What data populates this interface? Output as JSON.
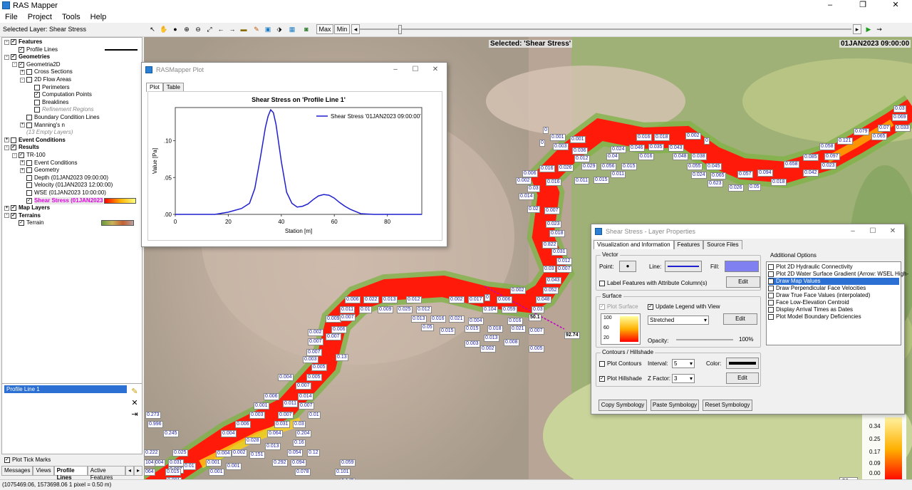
{
  "app": {
    "title": "RAS Mapper",
    "minimize": "–",
    "maximize": "❐",
    "close": "✕"
  },
  "menu": [
    "File",
    "Project",
    "Tools",
    "Help"
  ],
  "toolbar": {
    "selected_layer": "Selected Layer: Shear Stress",
    "max_label": "Max",
    "min_label": "Min"
  },
  "tree": [
    {
      "label": "Features",
      "lvl": 0,
      "exp": "-",
      "chk": "✓",
      "bold": true
    },
    {
      "label": "Profile Lines",
      "lvl": 1,
      "exp": "",
      "chk": "✓"
    },
    {
      "label": "Geometries",
      "lvl": 0,
      "exp": "-",
      "chk": "✓",
      "bold": true
    },
    {
      "label": "Geometria2D",
      "lvl": 1,
      "exp": "-",
      "chk": "✓"
    },
    {
      "label": "Cross Sections",
      "lvl": 2,
      "exp": "+",
      "chk": ""
    },
    {
      "label": "2D Flow Areas",
      "lvl": 2,
      "exp": "-",
      "chk": ""
    },
    {
      "label": "Perimeters",
      "lvl": 3,
      "exp": "",
      "chk": ""
    },
    {
      "label": "Computation Points",
      "lvl": 3,
      "exp": "",
      "chk": "✓"
    },
    {
      "label": "Breaklines",
      "lvl": 3,
      "exp": "",
      "chk": ""
    },
    {
      "label": "Refinement Regions",
      "lvl": 3,
      "exp": "",
      "chk": "",
      "gray": true
    },
    {
      "label": "Boundary Condition Lines",
      "lvl": 2,
      "exp": "",
      "chk": ""
    },
    {
      "label": "Manning's n",
      "lvl": 2,
      "exp": "+",
      "chk": ""
    },
    {
      "label": "(13 Empty Layers)",
      "lvl": 2,
      "exp": "",
      "chk": null,
      "gray": true
    },
    {
      "label": "Event Conditions",
      "lvl": 0,
      "exp": "+",
      "chk": "",
      "bold": true
    },
    {
      "label": "Results",
      "lvl": 0,
      "exp": "-",
      "chk": "✓",
      "bold": true
    },
    {
      "label": "TR-100",
      "lvl": 1,
      "exp": "-",
      "chk": "✓"
    },
    {
      "label": "Event Conditions",
      "lvl": 2,
      "exp": "+",
      "chk": ""
    },
    {
      "label": "Geometry",
      "lvl": 2,
      "exp": "+",
      "chk": ""
    },
    {
      "label": "Depth (01JAN2023 09:00:00)",
      "lvl": 2,
      "exp": "",
      "chk": ""
    },
    {
      "label": "Velocity (01JAN2023 12:00:00)",
      "lvl": 2,
      "exp": "",
      "chk": ""
    },
    {
      "label": "WSE (01JAN2023 10:00:00)",
      "lvl": 2,
      "exp": "",
      "chk": ""
    },
    {
      "label": "Shear Stress (01JAN2023",
      "lvl": 2,
      "exp": "",
      "chk": "✓",
      "sel": true
    },
    {
      "label": "Map Layers",
      "lvl": 0,
      "exp": "+",
      "chk": "✓",
      "bold": true
    },
    {
      "label": "Terrains",
      "lvl": 0,
      "exp": "-",
      "chk": "✓",
      "bold": true
    },
    {
      "label": "Terrain",
      "lvl": 1,
      "exp": "",
      "chk": "✓"
    }
  ],
  "profile_list": {
    "item": "Profile Line 1",
    "plot_tick_marks": "Plot Tick Marks"
  },
  "left_tabs": [
    "Messages",
    "Views",
    "Profile Lines",
    "Active Features"
  ],
  "status": "(1075469.06, 1573698.06  1 pixel = 0.50 m)",
  "map": {
    "selected": "Selected: 'Shear Stress'",
    "date": "01JAN2023 09:00:00",
    "scale": "50 m",
    "legend_values": [
      "0.34",
      "0.25",
      "0.17",
      "0.09",
      "0.00"
    ],
    "profile_value": "92.74",
    "profile_label": "50.1",
    "labels": [
      [
        "0",
        762,
        178
      ],
      [
        "0.001",
        772,
        188
      ],
      [
        "0.001",
        800,
        191
      ],
      [
        "0",
        757,
        196
      ],
      [
        "0.003",
        776,
        201
      ],
      [
        "0.036",
        803,
        207
      ],
      [
        "0.016",
        893,
        188
      ],
      [
        "0.018",
        918,
        188
      ],
      [
        "0.002",
        962,
        186
      ],
      [
        "0",
        988,
        193
      ],
      [
        "0.024",
        857,
        205
      ],
      [
        "0.046",
        883,
        203
      ],
      [
        "0.035",
        910,
        202
      ],
      [
        "0.043",
        938,
        203
      ],
      [
        "0.012",
        806,
        218
      ],
      [
        "0.04",
        851,
        215
      ],
      [
        "0.016",
        896,
        215
      ],
      [
        "0.048",
        944,
        215
      ],
      [
        "0.038",
        970,
        215
      ],
      [
        "0.016",
        757,
        232
      ],
      [
        "0.026",
        783,
        231
      ],
      [
        "0.029",
        816,
        229
      ],
      [
        "0.056",
        843,
        229
      ],
      [
        "0.015",
        872,
        229
      ],
      [
        "0.055",
        964,
        229
      ],
      [
        "0.045",
        991,
        229
      ],
      [
        "0.011",
        857,
        240
      ],
      [
        "0.006",
        733,
        239
      ],
      [
        "0.024",
        970,
        241
      ],
      [
        "0.065",
        997,
        242
      ],
      [
        "0.057",
        1035,
        240
      ],
      [
        "0.094",
        1063,
        238
      ],
      [
        "0.658",
        1100,
        226
      ],
      [
        "0.042",
        1127,
        238
      ],
      [
        "0.085",
        1127,
        216
      ],
      [
        "0.058",
        1150,
        201
      ],
      [
        "0.097",
        1157,
        215
      ],
      [
        "0.023",
        1152,
        228
      ],
      [
        "0.121",
        1175,
        193
      ],
      [
        "0.079",
        1198,
        180
      ],
      [
        "0.065",
        1223,
        187
      ],
      [
        "0.07",
        1232,
        175
      ],
      [
        "0.033",
        1256,
        175
      ],
      [
        "0.069",
        1252,
        160
      ],
      [
        "0.03",
        1254,
        148
      ],
      [
        "0.002",
        724,
        249
      ],
      [
        "0.016",
        766,
        251
      ],
      [
        "0.011",
        806,
        249
      ],
      [
        "0.015",
        833,
        248
      ],
      [
        "0.623",
        993,
        253
      ],
      [
        "0.026",
        1022,
        259
      ],
      [
        "0.05",
        1050,
        258
      ],
      [
        "0.018",
        1082,
        251
      ],
      [
        "0.03",
        740,
        260
      ],
      [
        "0.014",
        728,
        271
      ],
      [
        "0.02",
        740,
        289
      ],
      [
        "0.007",
        764,
        291
      ],
      [
        "0.023",
        766,
        310
      ],
      [
        "0.018",
        771,
        323
      ],
      [
        "0.822",
        761,
        339
      ],
      [
        "0.031",
        774,
        349
      ],
      [
        "0.012",
        781,
        362
      ],
      [
        "0.03",
        762,
        373
      ],
      [
        "0.007",
        781,
        373
      ],
      [
        "0.043",
        766,
        389
      ],
      [
        "0.052",
        762,
        403
      ],
      [
        "0.048",
        752,
        416
      ],
      [
        "0.006",
        484,
        416
      ],
      [
        "0.022",
        510,
        416
      ],
      [
        "0.013",
        536,
        416
      ],
      [
        "0.012",
        570,
        416
      ],
      [
        "0.002",
        630,
        416
      ],
      [
        "0.017",
        657,
        416
      ],
      [
        "0",
        680,
        413
      ],
      [
        "0.006",
        697,
        416
      ],
      [
        "0.002",
        716,
        403
      ],
      [
        "0.011",
        477,
        430
      ],
      [
        "0.01",
        504,
        430
      ],
      [
        "0.009",
        530,
        430
      ],
      [
        "0.025",
        557,
        430
      ],
      [
        "0.012",
        584,
        430
      ],
      [
        "0.104",
        677,
        430
      ],
      [
        "0.059",
        704,
        430
      ],
      [
        "0.03",
        746,
        430
      ],
      [
        "0.009",
        457,
        443
      ],
      [
        "0.007",
        477,
        441
      ],
      [
        "0.013",
        577,
        443
      ],
      [
        "0.016",
        604,
        443
      ],
      [
        "0.021",
        630,
        443
      ],
      [
        "0.004",
        657,
        446
      ],
      [
        "0.016",
        712,
        446
      ],
      [
        "0.05",
        591,
        455
      ],
      [
        "0.015",
        617,
        460
      ],
      [
        "0.015",
        652,
        457
      ],
      [
        "0.018",
        684,
        457
      ],
      [
        "0.021",
        716,
        457
      ],
      [
        "0.007",
        742,
        460
      ],
      [
        "0.013",
        679,
        470
      ],
      [
        "0.008",
        707,
        476
      ],
      [
        "0.003",
        652,
        478
      ],
      [
        "0.002",
        674,
        485
      ],
      [
        "0.005",
        742,
        485
      ],
      [
        "0.006",
        465,
        458
      ],
      [
        "0.002",
        432,
        462
      ],
      [
        "0.007",
        457,
        468
      ],
      [
        "0.007",
        432,
        475
      ],
      [
        "0.007",
        430,
        490
      ],
      [
        "0.003",
        425,
        500
      ],
      [
        "0.005",
        437,
        511
      ],
      [
        "0.13",
        471,
        497
      ],
      [
        "0.005",
        430,
        525
      ],
      [
        "0.004",
        390,
        525
      ],
      [
        "0.007",
        415,
        537
      ],
      [
        "0.014",
        418,
        552
      ],
      [
        "0.006",
        370,
        552
      ],
      [
        "0.001",
        356,
        565
      ],
      [
        "0.011",
        397,
        562
      ],
      [
        "0.007",
        419,
        565
      ],
      [
        "0.003",
        350,
        578
      ],
      [
        "0.007",
        390,
        578
      ],
      [
        "0.01",
        432,
        578
      ],
      [
        "0.006",
        330,
        591
      ],
      [
        "0.031",
        385,
        591
      ],
      [
        "0.03",
        411,
        591
      ],
      [
        "0.004",
        310,
        604
      ],
      [
        "0.064",
        375,
        604
      ],
      [
        "0.204",
        415,
        604
      ],
      [
        "0.028",
        344,
        614
      ],
      [
        "0.013",
        372,
        622
      ],
      [
        "0.16",
        411,
        617
      ],
      [
        "0.004",
        303,
        632
      ],
      [
        "0.002",
        325,
        631
      ],
      [
        "0.151",
        350,
        634
      ],
      [
        "0.054",
        403,
        631
      ],
      [
        "0.12",
        431,
        631
      ],
      [
        "0.001",
        289,
        645
      ],
      [
        "0.292",
        382,
        645
      ],
      [
        "0.094",
        408,
        645
      ],
      [
        "0.001",
        317,
        650
      ],
      [
        "0.001",
        293,
        658
      ],
      [
        "0.078",
        414,
        658
      ],
      [
        "0.059",
        477,
        645
      ],
      [
        "0.101",
        470,
        658
      ],
      [
        "0.145",
        477,
        671
      ],
      [
        "0.273",
        204,
        578
      ],
      [
        "0.996",
        207,
        591
      ],
      [
        "0.245",
        229,
        604
      ],
      [
        "0.222",
        202,
        631
      ],
      [
        "0.025",
        242,
        631
      ],
      [
        "0.031",
        236,
        645
      ],
      [
        "0.004",
        210,
        645
      ],
      [
        "104",
        202,
        645
      ],
      [
        "0.007",
        236,
        655
      ],
      [
        "0.015",
        232,
        658
      ],
      [
        "0.01",
        257,
        650
      ],
      [
        "0.001",
        233,
        670
      ],
      [
        "0.001",
        256,
        676
      ],
      [
        "064",
        202,
        658
      ]
    ]
  },
  "plot": {
    "window_title": "RASMapper Plot",
    "tabs": [
      "Plot",
      "Table"
    ],
    "chart_data": {
      "type": "line",
      "title": "Shear Stress on 'Profile Line 1'",
      "xlabel": "Station [m]",
      "ylabel": "Value [Pa]",
      "xlim": [
        0,
        93
      ],
      "ylim": [
        0,
        0.145
      ],
      "xticks": [
        0,
        20,
        40,
        60,
        80
      ],
      "yticks": [
        0,
        0.05,
        0.1
      ],
      "ytick_labels": [
        ".00",
        ".05",
        ".10"
      ],
      "legend_position": "top-right",
      "series": [
        {
          "name": "Shear Stress '01JAN2023 09:00:00'",
          "color": "#1f1fcf",
          "x": [
            0,
            15,
            20,
            25,
            28,
            30,
            32,
            34,
            35,
            36,
            37,
            38,
            40,
            42,
            44,
            46,
            48,
            50,
            52,
            54,
            56,
            58,
            60,
            62,
            64,
            66,
            68,
            70,
            75,
            93
          ],
          "y": [
            0,
            0,
            0.003,
            0.008,
            0.015,
            0.035,
            0.075,
            0.118,
            0.133,
            0.142,
            0.138,
            0.122,
            0.072,
            0.03,
            0.015,
            0.01,
            0.011,
            0.014,
            0.02,
            0.025,
            0.027,
            0.026,
            0.022,
            0.016,
            0.011,
            0.007,
            0.004,
            0.001,
            0,
            0
          ]
        }
      ]
    }
  },
  "props": {
    "window_title": "Shear Stress - Layer Properties",
    "tabs": [
      "Visualization and Information",
      "Features",
      "Source Files"
    ],
    "vector": "Vector",
    "point": "Point:",
    "line": "Line:",
    "fill": "Fill:",
    "label_features": "Label Features with Attribute Column(s)",
    "edit": "Edit",
    "surface": "Surface",
    "plot_surface": "Plot Surface",
    "update_legend": "Update Legend with View",
    "stretch": "Stretched",
    "opacity": "Opacity:",
    "opacity_value": "100%",
    "contours": "Contours / Hillshade",
    "plot_contours": "Plot Contours",
    "interval": "Interval:",
    "interval_value": "5",
    "color": "Color:",
    "plot_hillshade": "Plot Hillshade",
    "zfactor": "Z Factor:",
    "zfactor_value": "3",
    "legend": [
      "100",
      "60",
      "20"
    ],
    "additional": "Additional Options",
    "options": [
      "Plot 2D Hydraulic Connectivity",
      "Plot 2D Water Surface Gradient (Arrow: WSEL High-",
      "Draw Map Values",
      "Draw Perpendicular Face Velocities",
      "Draw True Face Values (interpolated)",
      "Face Low-Elevation Centroid",
      "Display Arrival Times as Dates",
      "Plot Model Boundary Deficiencies"
    ],
    "copy": "Copy Symbology",
    "paste": "Paste Symbology",
    "reset": "Reset Symbology",
    "fill_color": "#8080f0"
  }
}
